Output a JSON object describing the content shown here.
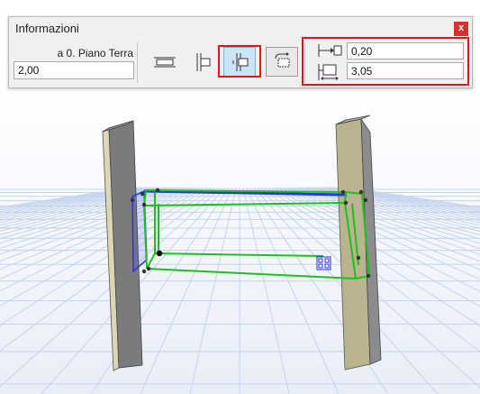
{
  "window": {
    "title": "Informazioni",
    "close_label": "x"
  },
  "left": {
    "floor_label": "a 0. Piano Terra",
    "height_value": "2,00"
  },
  "toolbar": {
    "buttons": [
      {
        "icon": "anchor-both-sides-icon",
        "state": "normal"
      },
      {
        "icon": "anchor-left-side-icon",
        "state": "normal"
      },
      {
        "icon": "anchor-center-icon",
        "state": "selected"
      },
      {
        "icon": "custom-position-icon",
        "state": "raised"
      }
    ]
  },
  "params": {
    "offset": {
      "icon": "offset-distance-icon",
      "value": "0,20"
    },
    "depth": {
      "icon": "opening-depth-icon",
      "value": "3,05"
    }
  },
  "colors": {
    "highlight": "#e0141e",
    "selection": "#1fbf1f",
    "edge_blue": "#1f2bd6",
    "wall_dark": "#7b7b7d",
    "wall_light": "#b9b48f",
    "grid": "#bcd0ec"
  }
}
